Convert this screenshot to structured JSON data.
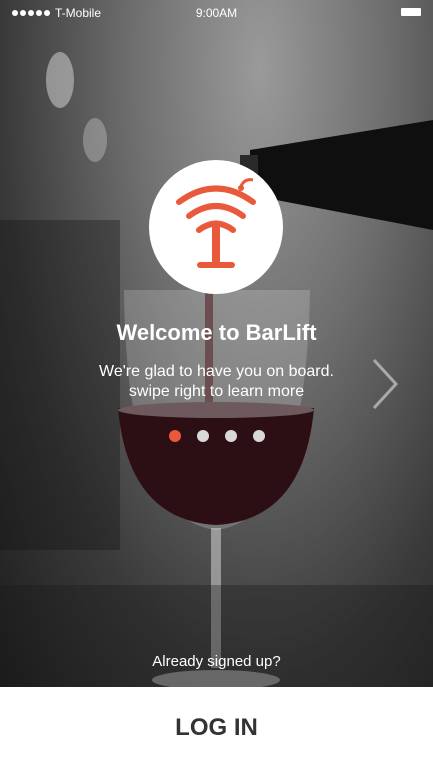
{
  "status_bar": {
    "carrier": "T-Mobile",
    "time": "9:00AM"
  },
  "onboarding": {
    "title": "Welcome to BarLift",
    "subtitle_line1": "We're glad to have you on board.",
    "subtitle_line2": "swipe right to learn more",
    "page_indicator": {
      "current": 1,
      "total": 4
    }
  },
  "already_signed_up": "Already signed up?",
  "login_label": "LOG IN",
  "colors": {
    "accent": "#e85a3b",
    "text_dark": "#333333"
  }
}
